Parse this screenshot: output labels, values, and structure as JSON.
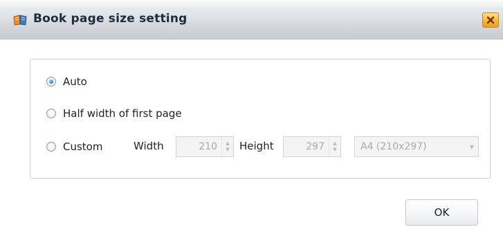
{
  "window": {
    "title": "Book page size setting",
    "icon": "book-app-icon",
    "close_icon": "close-icon"
  },
  "options": {
    "auto_label": "Auto",
    "auto_selected": true,
    "half_label": "Half width of first page",
    "half_selected": false,
    "custom_label": "Custom",
    "custom_selected": false
  },
  "custom": {
    "width_label": "Width",
    "width_value": "210",
    "height_label": "Height",
    "height_value": "297",
    "preset_value": "A4 (210x297)",
    "enabled": false
  },
  "footer": {
    "ok_label": "OK"
  },
  "colors": {
    "accent": "#2e86de",
    "close_button": "#f6b73c"
  }
}
